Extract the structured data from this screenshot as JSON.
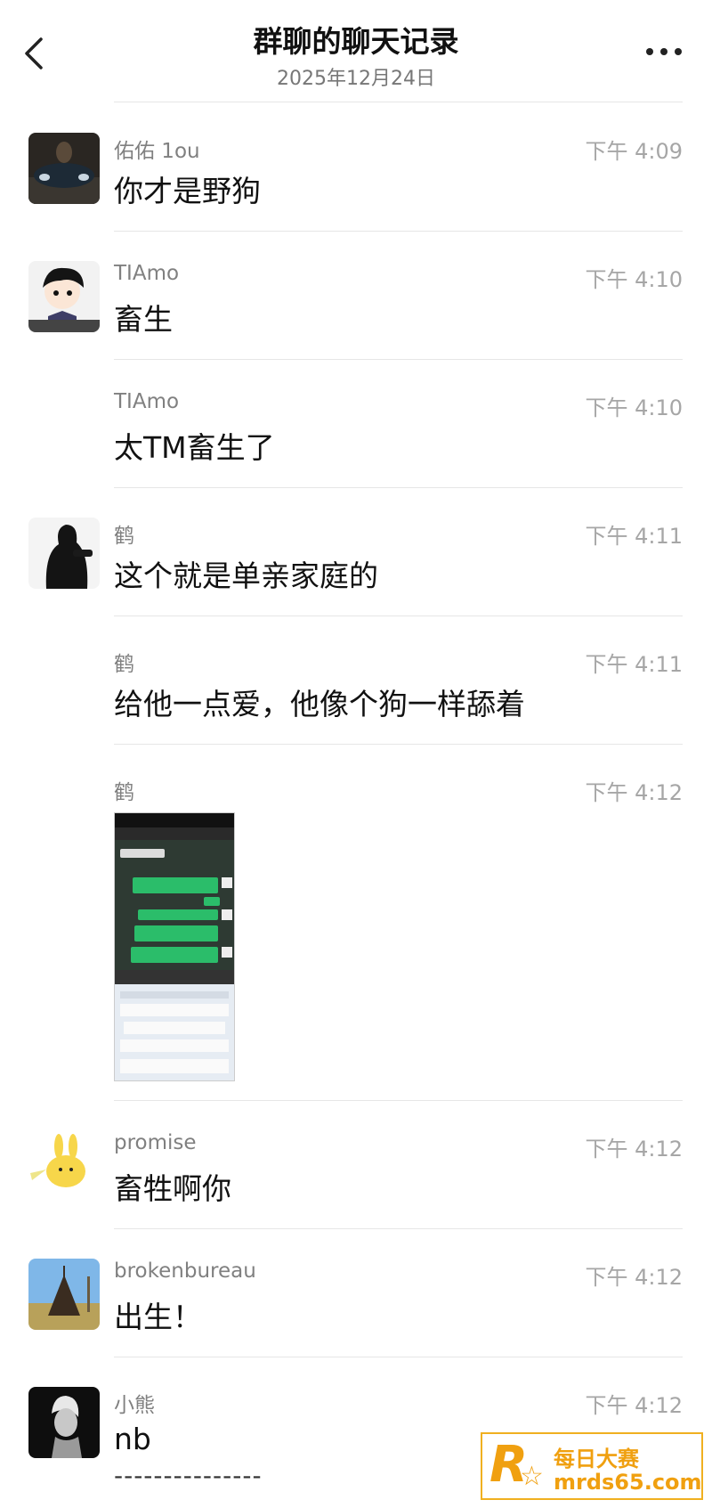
{
  "header": {
    "title": "群聊的聊天记录",
    "date": "2025年12月24日"
  },
  "messages": [
    {
      "sender": "佑佑 1ou",
      "time": "下午 4:09",
      "text": "你才是野狗",
      "avatar": "car-night-photo"
    },
    {
      "sender": "TIAmo",
      "time": "下午 4:10",
      "text": "畜生",
      "avatar": "anime-boy-bowtie"
    },
    {
      "sender": "TIAmo",
      "time": "下午 4:10",
      "text": "太TM畜生了",
      "avatar": ""
    },
    {
      "sender": "鹤",
      "time": "下午 4:11",
      "text": "这个就是单亲家庭的",
      "avatar": "person-black-hoodie"
    },
    {
      "sender": "鹤",
      "time": "下午 4:11",
      "text": "给他一点爱，他像个狗一样舔着",
      "avatar": ""
    },
    {
      "sender": "鹤",
      "time": "下午 4:12",
      "text": "",
      "image": "chat-screenshot-thumbnail",
      "avatar": ""
    },
    {
      "sender": "promise",
      "time": "下午 4:12",
      "text": "畜牲啊你",
      "avatar": "yellow-bunny-cartoon"
    },
    {
      "sender": "brokenbureau",
      "time": "下午 4:12",
      "text": "出生！",
      "avatar": "teepee-landscape"
    },
    {
      "sender": "小熊",
      "time": "下午 4:12",
      "text": "nb",
      "avatar": "monochrome-portrait"
    }
  ],
  "footer_dashes": "---------------",
  "watermark": {
    "logo_letter": "R",
    "line1": "每日大赛",
    "line2": "mrds65.com"
  },
  "colors": {
    "accent": "#f0a010",
    "chat_green": "#2bbd6a"
  }
}
